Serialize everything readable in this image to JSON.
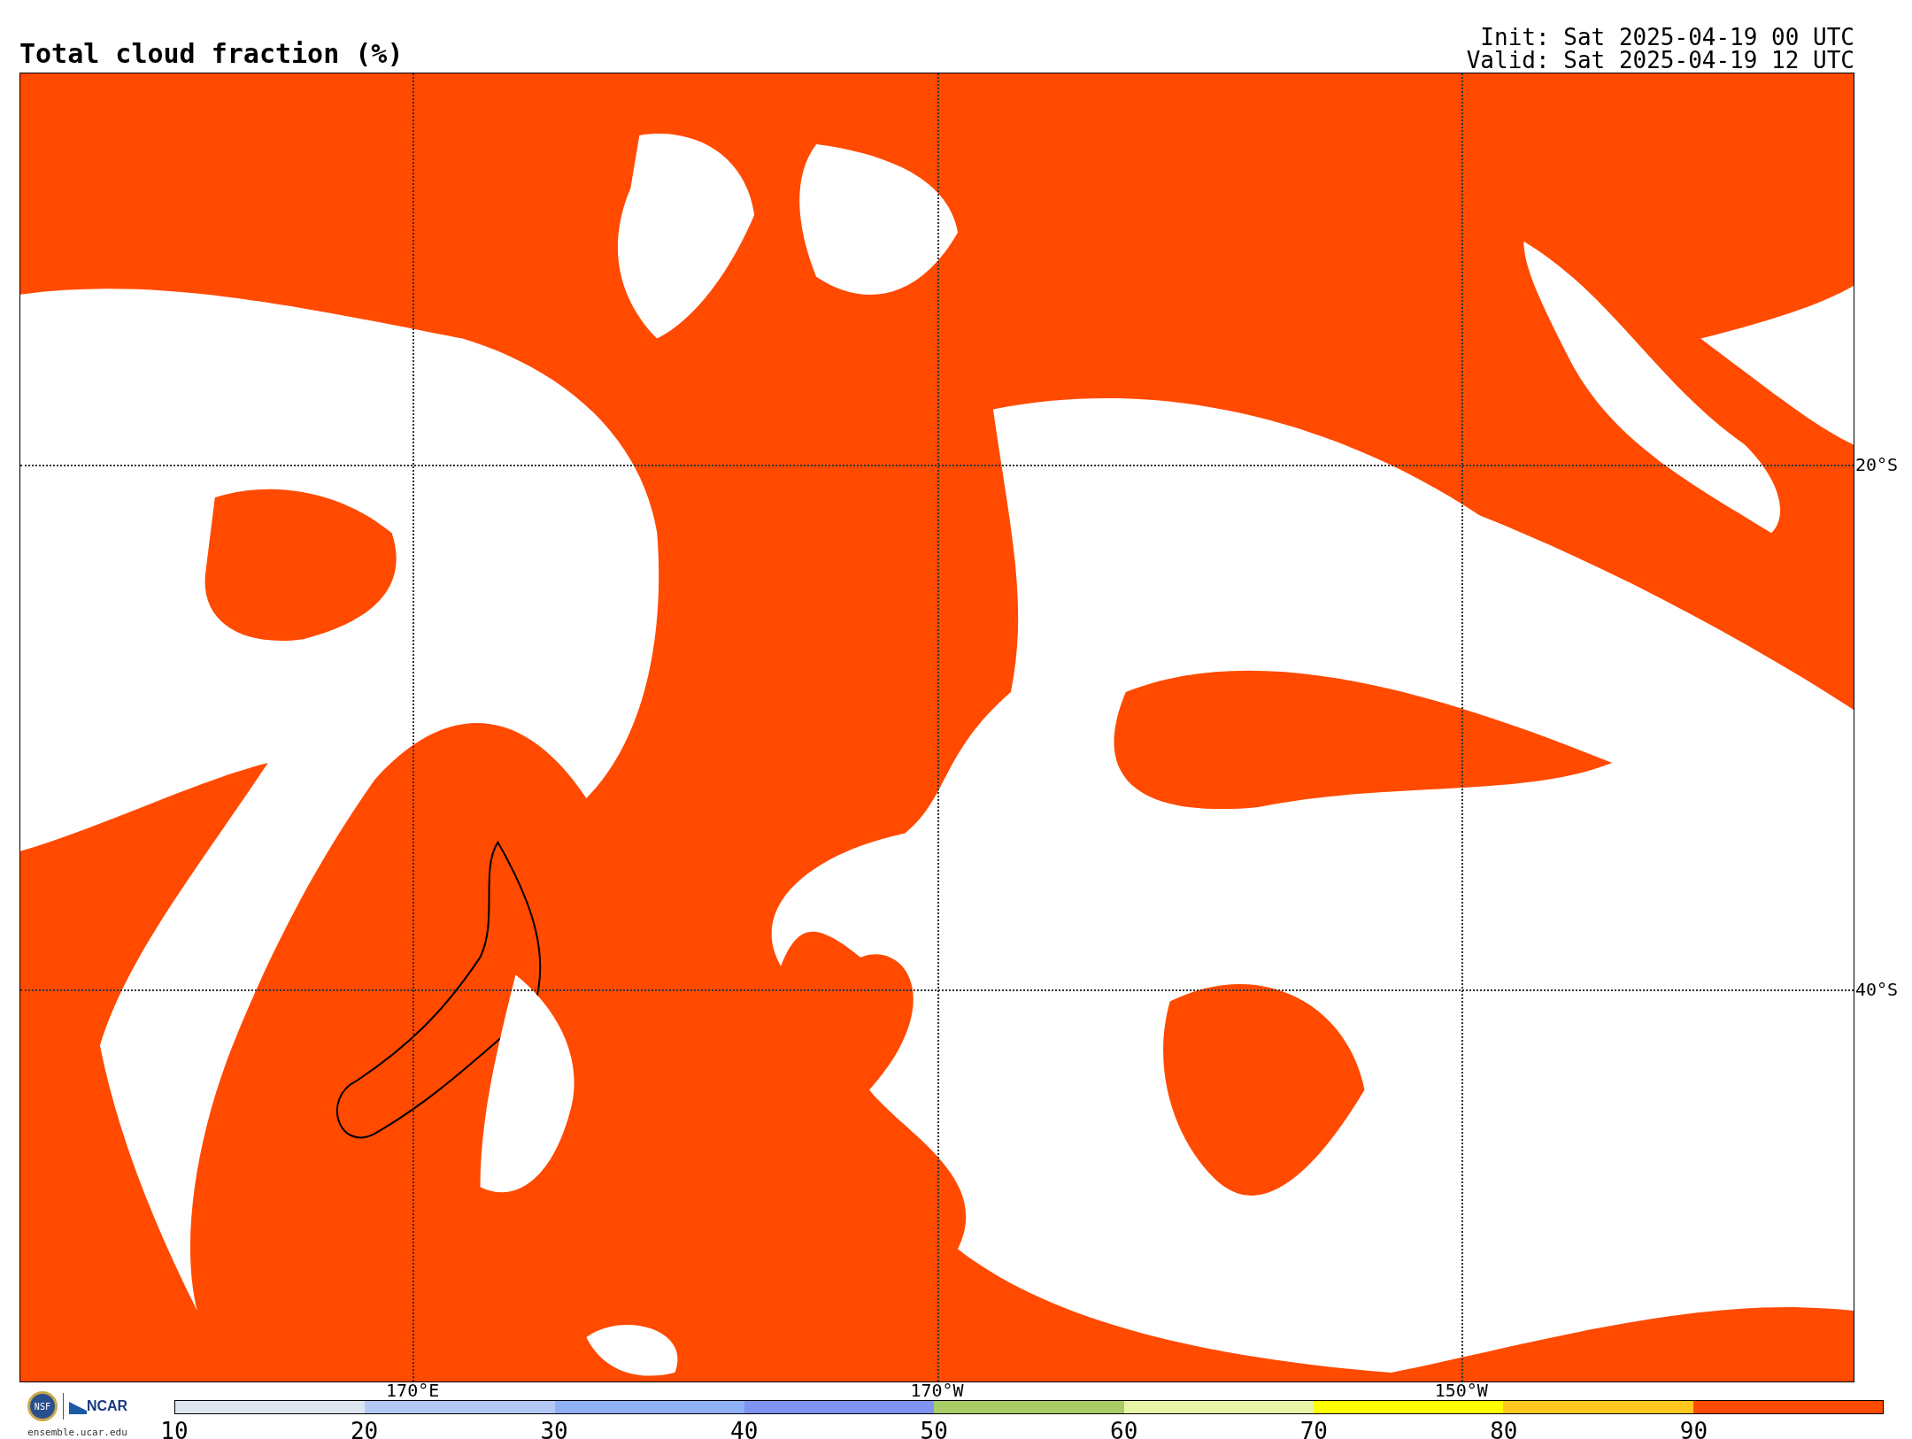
{
  "title": "Total cloud fraction (%)",
  "run_times": [
    "Init: Sat 2025-04-19 00 UTC",
    "Valid: Sat 2025-04-19 12 UTC"
  ],
  "map": {
    "longitude_labels": [
      "170°E",
      "170°W",
      "150°W"
    ],
    "latitude_labels": [
      "20°S",
      "40°S"
    ]
  },
  "logo": {
    "seal": "NSF",
    "org": "NCAR",
    "site": "ensemble.ucar.edu"
  },
  "colorbar": {
    "segments": [
      {
        "color": "#dde6ef"
      },
      {
        "color": "#b4c8f5"
      },
      {
        "color": "#8fb0f5"
      },
      {
        "color": "#7f93f0"
      },
      {
        "color": "#a8cc66"
      },
      {
        "color": "#e6f5a8"
      },
      {
        "color": "#ffff00"
      },
      {
        "color": "#ffc81e"
      },
      {
        "color": "#ff4a00"
      }
    ],
    "tick_labels": [
      "10",
      "20",
      "30",
      "40",
      "50",
      "60",
      "70",
      "80",
      "90"
    ]
  }
}
